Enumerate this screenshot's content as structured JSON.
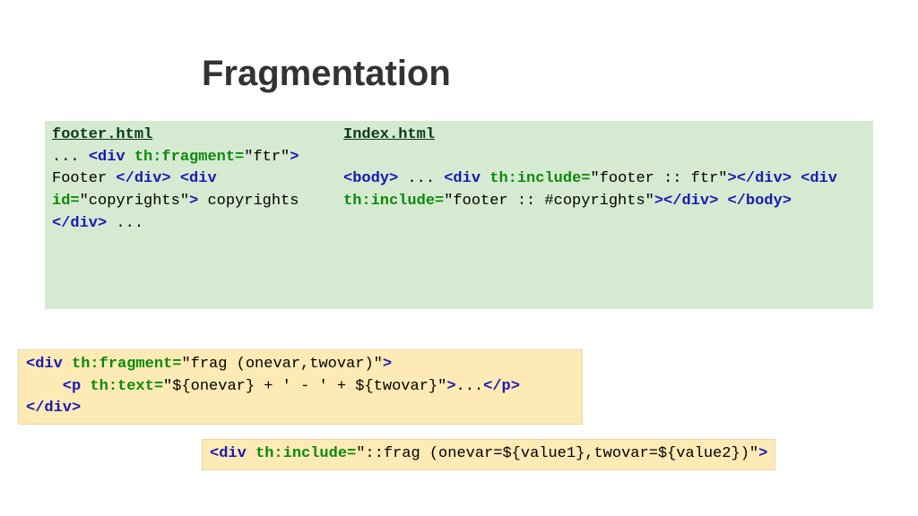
{
  "title": "Fragmentation",
  "green": {
    "left": {
      "filename": "footer.html",
      "l1": "...",
      "l2a": "<div ",
      "l2b": "th:fragment=",
      "l2c": "\"ftr\"",
      "l2d": ">",
      "l3": "   Footer",
      "l4": "</div>",
      "l5a": "<div ",
      "l5b": "id=",
      "l5c": "\"copyrights\"",
      "l5d": ">",
      "l6": " copyrights",
      "l7": "</div>",
      "l8": "..."
    },
    "right": {
      "filename": "Index.html",
      "l1": "<body>",
      "l2": "...",
      "l3a": "<div ",
      "l3b": "th:include=",
      "l3c": "\"footer :: ftr\"",
      "l3d": ">",
      "l3e": "</div>",
      "l4a": "<div ",
      "l4b": "th:include=",
      "l4c": "\"footer :: #copyrights\"",
      "l4d": ">",
      "l4e": "</div>",
      "l5": "</body>"
    }
  },
  "yellow1": {
    "l1a": "<div ",
    "l1b": "th:fragment=",
    "l1c": "\"frag (onevar,twovar)\"",
    "l1d": ">",
    "l2a": "    <p ",
    "l2b": "th:text=",
    "l2c": "\"${onevar} + ' - ' + ${twovar}\"",
    "l2d": ">",
    "l2e": "...",
    "l2f": "</p>",
    "l3": "</div>"
  },
  "yellow2": {
    "l1a": "<div ",
    "l1b": "th:include=",
    "l1c": "\"::frag (onevar=${value1},twovar=${value2})\"",
    "l1d": ">"
  }
}
